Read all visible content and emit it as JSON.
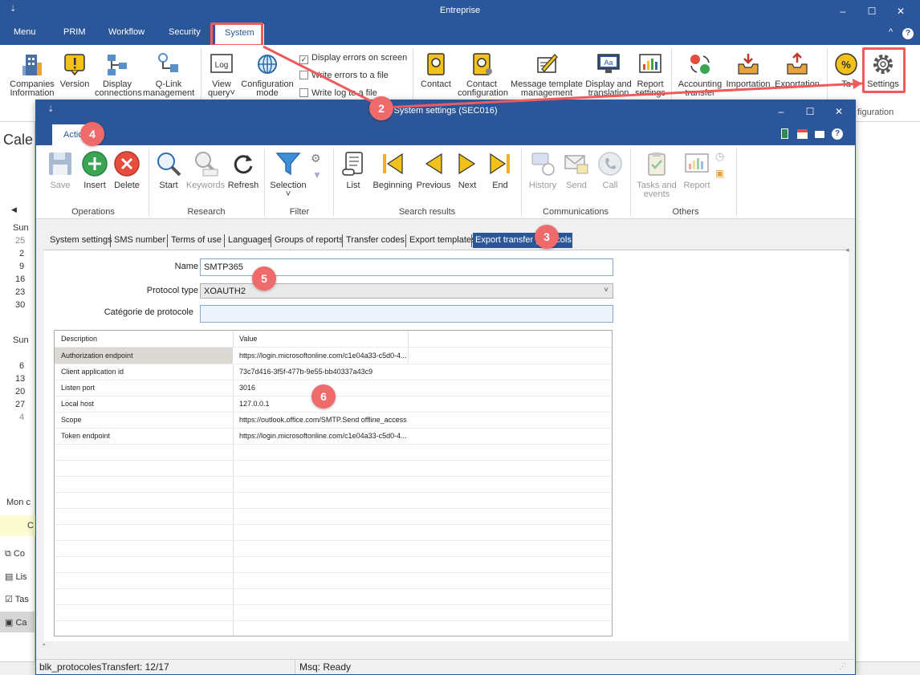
{
  "main_window": {
    "title": "Entreprise",
    "controls": {
      "minimize": "–",
      "maximize": "☐",
      "close": "✕"
    },
    "menu": [
      "Menu",
      "PRIM",
      "Workflow",
      "Security",
      "System"
    ],
    "help": {
      "collapse": "^",
      "help": "?"
    }
  },
  "ribbon": {
    "buttons": [
      {
        "label": "Companies",
        "sub": "Information"
      },
      {
        "label": "Version",
        "sub": ""
      },
      {
        "label": "Display",
        "sub": "connections"
      },
      {
        "label": "Q-Link",
        "sub": "management"
      },
      {
        "label": "View",
        "sub": "query˅"
      },
      {
        "label": "Configuration",
        "sub": "mode"
      },
      {
        "label": "Contact",
        "sub": ""
      },
      {
        "label": "Contact",
        "sub": "configuration"
      },
      {
        "label": "Message template",
        "sub": "management"
      },
      {
        "label": "Display and",
        "sub": "translation"
      },
      {
        "label": "Report",
        "sub": "settings"
      },
      {
        "label": "Accounting",
        "sub": "transfer"
      },
      {
        "label": "Importation",
        "sub": ""
      },
      {
        "label": "Exportation",
        "sub": ""
      },
      {
        "label": "Ta",
        "sub": ""
      },
      {
        "label": "Settings",
        "sub": ""
      }
    ],
    "checks": [
      {
        "label": "Display errors on screen",
        "checked": "✓"
      },
      {
        "label": "Write errors to a file",
        "checked": ""
      },
      {
        "label": "Write log to a file",
        "checked": ""
      }
    ],
    "group_partial": "figuration"
  },
  "background": {
    "cale": "Cale",
    "arrow": "◀",
    "col1": [
      "Sun",
      "25",
      "2",
      "9",
      "16",
      "23",
      "30"
    ],
    "col2": [
      "Sun",
      "6",
      "13",
      "20",
      "27",
      "4"
    ],
    "mon": "Mon c",
    "c_item": "C",
    "nav": [
      "Co",
      "Lis",
      "Tas",
      "Ca"
    ]
  },
  "dialog": {
    "title": "System settings (SEC016)",
    "controls": {
      "minimize": "–",
      "maximize": "☐",
      "close": "✕"
    },
    "tab": "Actions",
    "ribbon": {
      "operations": {
        "label": "Operations",
        "buttons": [
          "Save",
          "Insert",
          "Delete"
        ]
      },
      "research": {
        "label": "Research",
        "buttons": [
          "Start",
          "Keywords",
          "Refresh"
        ]
      },
      "filter": {
        "label": "Filter",
        "buttons": [
          "Selection"
        ]
      },
      "search_results": {
        "label": "Search results",
        "buttons": [
          "List",
          "Beginning",
          "Previous",
          "Next",
          "End"
        ]
      },
      "communications": {
        "label": "Communications",
        "buttons": [
          "History",
          "Send",
          "Call"
        ]
      },
      "others": {
        "label": "Others",
        "buttons": [
          "Tasks and",
          "events",
          "Report"
        ]
      }
    },
    "tabs": [
      "System settings",
      "SMS number",
      "Terms of use",
      "Languages",
      "Groups of reports",
      "Transfer codes",
      "Export templates",
      "Export transfer protocols"
    ],
    "form": {
      "name_label": "Name",
      "name_value": "SMTP365",
      "protocol_label": "Protocol type",
      "protocol_value": "XOAUTH2",
      "category_label": "Catégorie de protocole",
      "category_value": ""
    },
    "grid": {
      "headers": [
        "Description",
        "Value"
      ],
      "rows": [
        [
          "Authorization endpoint",
          "https://login.microsoftonline.com/c1e04a33-c5d0-4..."
        ],
        [
          "Client application id",
          "73c7d416-3f5f-477b-9e55-bb40337a43c9"
        ],
        [
          "Listen port",
          "3016"
        ],
        [
          "Local host",
          "127.0.0.1"
        ],
        [
          "Scope",
          "https://outlook.office.com/SMTP.Send offline_access"
        ],
        [
          "Token endpoint",
          "https://login.microsoftonline.com/c1e04a33-c5d0-4..."
        ]
      ]
    },
    "status": {
      "left": "blk_protocolesTransfert: 12/17",
      "right": "Msq: Ready"
    },
    "dash": "-"
  },
  "annotations": [
    "2",
    "3",
    "4",
    "5",
    "6"
  ],
  "colors": {
    "accent": "#2b579a",
    "highlight": "#f05a5a",
    "badge": "#ef6a6a"
  }
}
